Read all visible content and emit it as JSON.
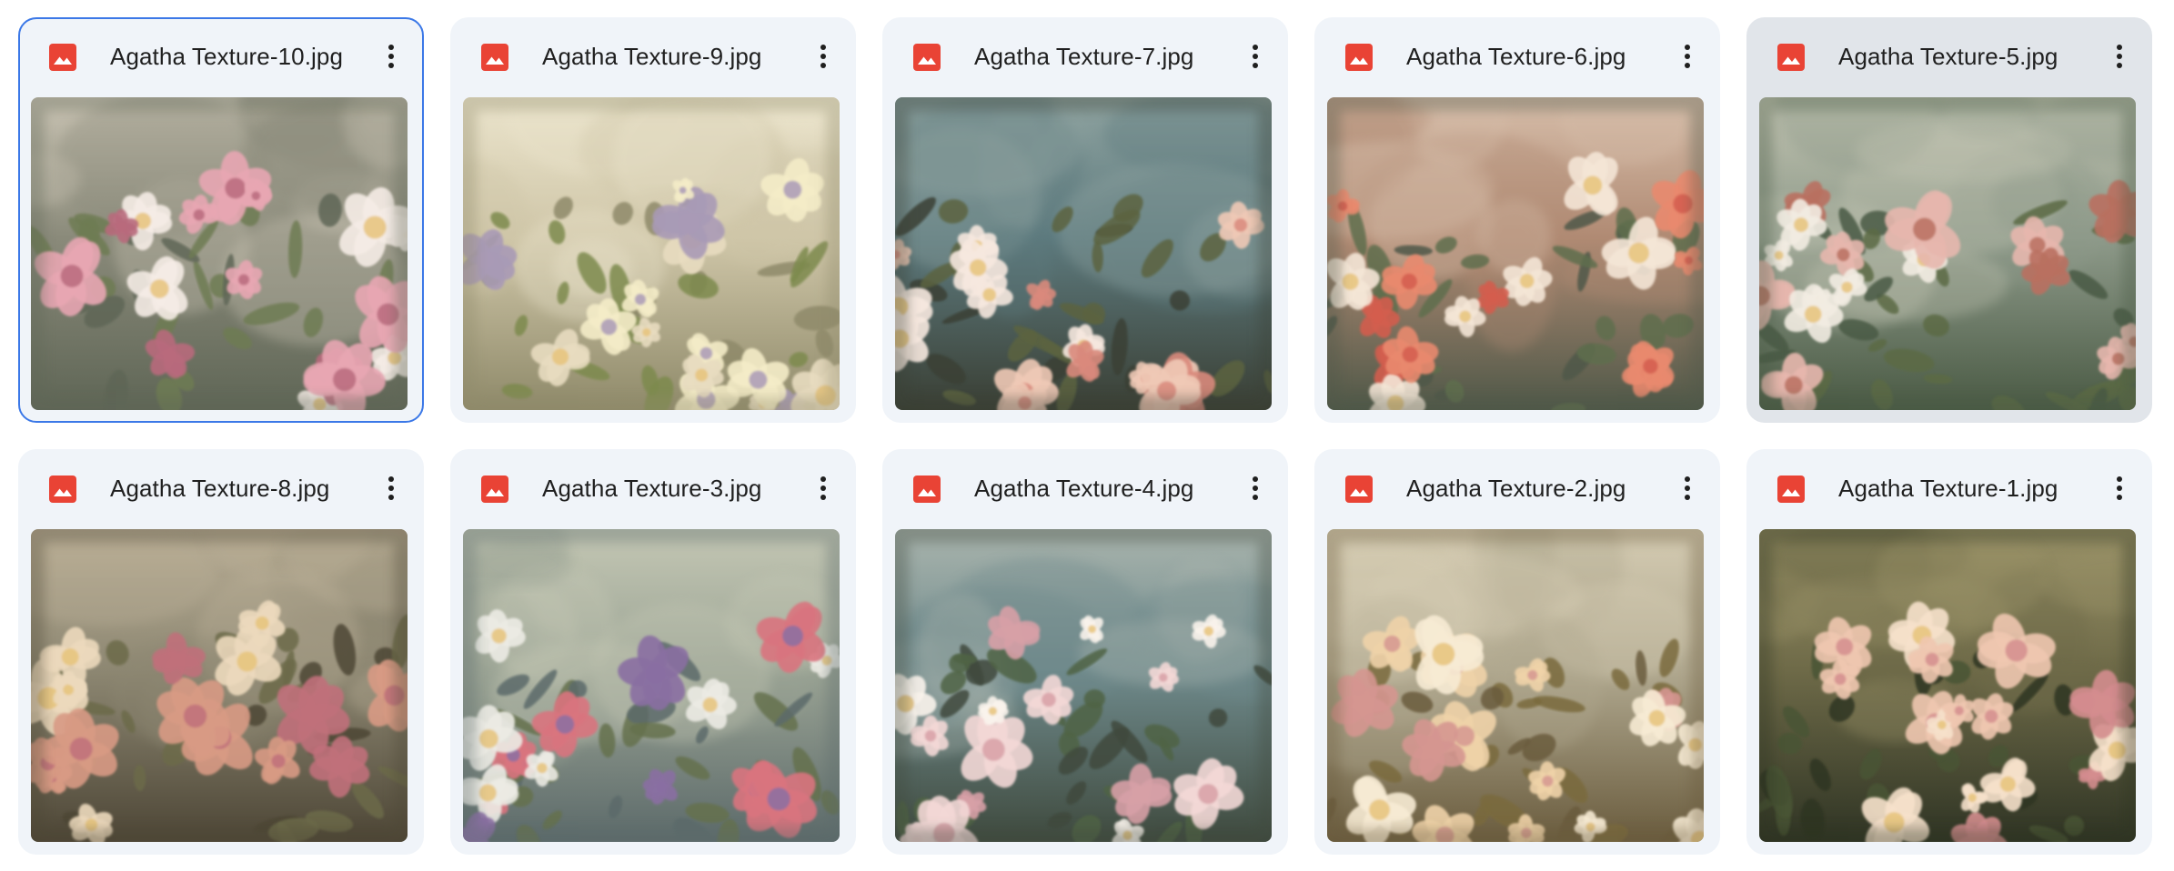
{
  "files": [
    {
      "name": "Agatha Texture-10.jpg",
      "state": "selected",
      "palette": {
        "bg1": "#8a8a7a",
        "bg2": "#c9c3b3",
        "bg3": "#5f6656",
        "f1": "#e8a6b2",
        "f2": "#f5ece6",
        "f3": "#b86a7c",
        "f4": "#6e7b52"
      }
    },
    {
      "name": "Agatha Texture-9.jpg",
      "state": "normal",
      "palette": {
        "bg1": "#cfc6a8",
        "bg2": "#ebe4cc",
        "bg3": "#8f8a6a",
        "f1": "#f4ecc8",
        "f2": "#e8dcc0",
        "f3": "#a99ab6",
        "f4": "#7d8a4e"
      }
    },
    {
      "name": "Agatha Texture-7.jpg",
      "state": "normal",
      "palette": {
        "bg1": "#5d7a7e",
        "bg2": "#8fa3a0",
        "bg3": "#3a3f34",
        "f1": "#f0c9b6",
        "f2": "#f6e8df",
        "f3": "#d98a7c",
        "f4": "#5b6440"
      }
    },
    {
      "name": "Agatha Texture-6.jpg",
      "state": "normal",
      "palette": {
        "bg1": "#b08a73",
        "bg2": "#d6bda9",
        "bg3": "#4f5848",
        "f1": "#e98a6e",
        "f2": "#f4e5d6",
        "f3": "#d35d4e",
        "f4": "#5e6e4e"
      }
    },
    {
      "name": "Agatha Texture-5.jpg",
      "state": "hovered",
      "palette": {
        "bg1": "#8e9a8a",
        "bg2": "#c0c2b0",
        "bg3": "#4a5a44",
        "f1": "#e7b7ae",
        "f2": "#f2ece2",
        "f3": "#b97060",
        "f4": "#5c6b44"
      }
    },
    {
      "name": "Agatha Texture-8.jpg",
      "state": "normal",
      "palette": {
        "bg1": "#8d8772",
        "bg2": "#b9ae96",
        "bg3": "#4d4636",
        "f1": "#d89a84",
        "f2": "#ecd9bd",
        "f3": "#c0707a",
        "f4": "#6c6a4a"
      }
    },
    {
      "name": "Agatha Texture-3.jpg",
      "state": "normal",
      "palette": {
        "bg1": "#9aa394",
        "bg2": "#c4c7b4",
        "bg3": "#5c6a6a",
        "f1": "#d9747e",
        "f2": "#ecebe4",
        "f3": "#8a6fa2",
        "f4": "#65714e"
      }
    },
    {
      "name": "Agatha Texture-4.jpg",
      "state": "normal",
      "palette": {
        "bg1": "#6f8a8c",
        "bg2": "#a9b4ad",
        "bg3": "#3f4a3e",
        "f1": "#f3d8d6",
        "f2": "#faf3ec",
        "f3": "#d7a0a6",
        "f4": "#4f6444"
      }
    },
    {
      "name": "Agatha Texture-2.jpg",
      "state": "normal",
      "palette": {
        "bg1": "#b0a88f",
        "bg2": "#d5ccb3",
        "bg3": "#6a5c3e",
        "f1": "#f0d3a8",
        "f2": "#f7ebd4",
        "f3": "#d59690",
        "f4": "#7a6b3c"
      }
    },
    {
      "name": "Agatha Texture-1.jpg",
      "state": "normal",
      "palette": {
        "bg1": "#6e6a48",
        "bg2": "#9a9268",
        "bg3": "#2f3424",
        "f1": "#efc7b0",
        "f2": "#f6e1cb",
        "f3": "#d48d8e",
        "f4": "#4a5434"
      }
    }
  ],
  "icon": {
    "image": "image-file-icon",
    "more": "more-vert-icon"
  },
  "colors": {
    "icon_red": "#e94335",
    "selection_border": "#3b78e7",
    "card_bg": "#f0f4f9",
    "card_hover_bg": "#e1e5ea",
    "text": "#1f1f1f"
  }
}
